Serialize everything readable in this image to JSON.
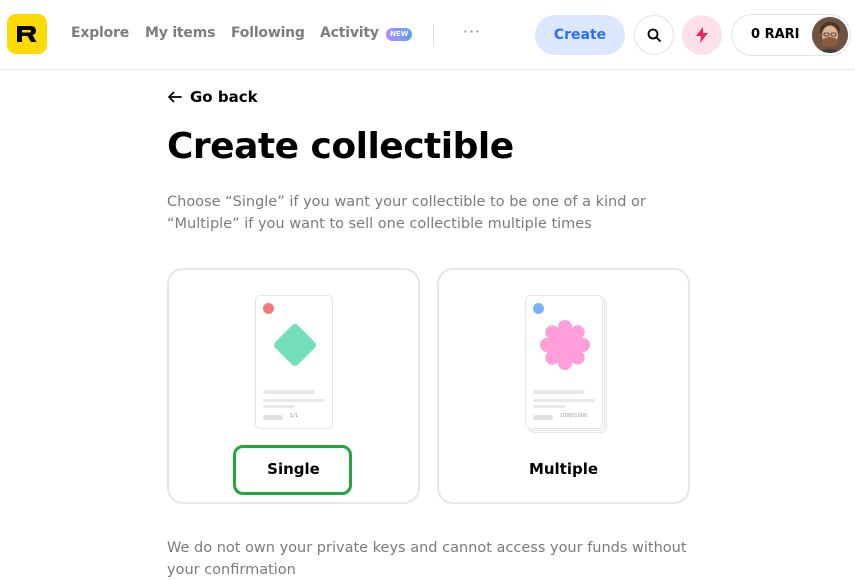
{
  "header": {
    "nav": {
      "explore": "Explore",
      "my_items": "My items",
      "following": "Following",
      "activity": "Activity",
      "new_badge": "NEW",
      "more": "···"
    },
    "create_label": "Create",
    "wallet_balance": "0 RARI",
    "colors": {
      "logo": "#FEDA03",
      "create_bg": "#dce8ff",
      "create_text": "#2a6df4",
      "bolt": "#f0245c"
    }
  },
  "main": {
    "go_back": "Go back",
    "title": "Create collectible",
    "description": "Choose “Single” if you want your collectible to be one of a kind or “Multiple” if you want to sell one collectible multiple times",
    "options": [
      {
        "label": "Single",
        "count": "1/1",
        "dot_color": "#f47a7a",
        "shape_color": "#74dfbd"
      },
      {
        "label": "Multiple",
        "count": "1000/1000",
        "dot_color": "#74b3ff",
        "shape_color": "#ff9ed9"
      }
    ],
    "footer_note": "We do not own your private keys and cannot access your funds without your confirmation"
  }
}
